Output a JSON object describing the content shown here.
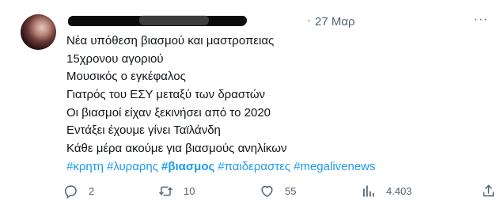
{
  "tweet": {
    "date": "27 Μαρ",
    "separator": "·",
    "lines": [
      "Νέα υπόθεση βιασμού και μαστροπειας",
      "15χρονου αγοριού",
      "Μουσικός ο εγκέφαλος",
      "Γιατρός του ΕΣΥ μεταξύ των δραστών",
      "Οι βιασμοί είχαν ξεκινήσει από το 2020",
      "Εντάξει έχουμε γίνει Ταϊλάνδη",
      "Κάθε μέρα ακούμε για βιασμούς ανηλίκων"
    ],
    "hashtags": [
      "#κρητη",
      "#λυραρης",
      "#βιασμος",
      "#παιδεραστες",
      "#megalivenews"
    ]
  },
  "actions": {
    "reply_count": "2",
    "retweet_count": "10",
    "like_count": "55",
    "views_count": "4.403"
  },
  "icons": {
    "avatar": "user-avatar",
    "more": "more-options-icon",
    "reply": "reply-icon",
    "retweet": "retweet-icon",
    "like": "heart-icon",
    "views": "views-icon",
    "share": "share-icon"
  },
  "colors": {
    "text": "#0f1419",
    "secondary": "#536471",
    "link": "#1d9bf0"
  }
}
